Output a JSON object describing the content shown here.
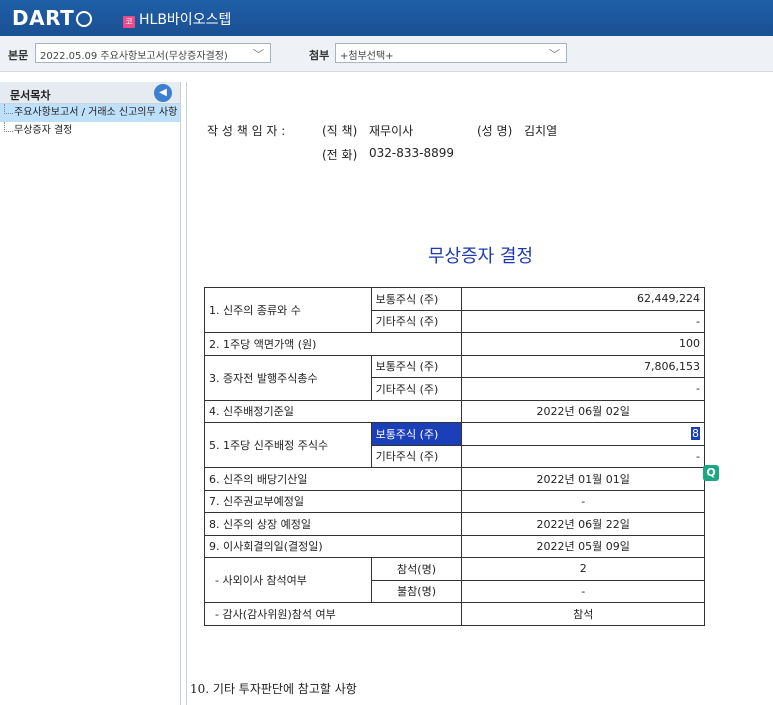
{
  "header": {
    "logo": "DART",
    "corp_badge": "코",
    "corp_name": "HLB바이오스텝"
  },
  "toolbar": {
    "main_label": "본문",
    "main_value": "2022.05.09  주요사항보고서(무상증자결정)",
    "attach_label": "첨부",
    "attach_value": "+첨부선택+"
  },
  "sidebar": {
    "title": "문서목차",
    "items": [
      {
        "label": "주요사항보고서 / 거래소 신고의무 사항"
      },
      {
        "label": "무상증자 결정"
      }
    ]
  },
  "signer": {
    "role_label": "작 성 책 임 자 :",
    "position_label": "(직  책)",
    "position_value": "재무이사",
    "name_label": "(성  명)",
    "name_value": "김치열",
    "phone_label": "(전  화)",
    "phone_value": "032-833-8899"
  },
  "doc_title": "무상증자 결정",
  "table": {
    "r1_label": "1. 신주의 종류와 수",
    "r1a_type": "보통주식 (주)",
    "r1a_value": "62,449,224",
    "r1b_type": "기타주식 (주)",
    "r1b_value": "-",
    "r2_label": "2. 1주당 액면가액 (원)",
    "r2_value": "100",
    "r3_label": "3. 증자전 발행주식총수",
    "r3a_type": "보통주식 (주)",
    "r3a_value": "7,806,153",
    "r3b_type": "기타주식 (주)",
    "r3b_value": "-",
    "r4_label": "4. 신주배정기준일",
    "r4_value": "2022년 06월 02일",
    "r5_label": "5. 1주당 신주배정 주식수",
    "r5a_type": "보통주식 (주)",
    "r5a_value": "8",
    "r5b_type": "기타주식 (주)",
    "r5b_value": "-",
    "r6_label": "6. 신주의 배당기산일",
    "r6_value": "2022년 01월 01일",
    "r7_label": "7. 신주권교부예정일",
    "r7_value": "-",
    "r8_label": "8. 신주의 상장 예정일",
    "r8_value": "2022년 06월 22일",
    "r9_label": "9. 이사회결의일(결정일)",
    "r9_value": "2022년 05월 09일",
    "r10_label": "- 사외이사 참석여부",
    "r10a_type": "참석(명)",
    "r10a_value": "2",
    "r10b_type": "불참(명)",
    "r10b_value": "-",
    "r11_label": "- 감사(감사위원)참석 여부",
    "r11_value": "참석"
  },
  "footer_note": "10. 기타 투자판단에 참고할 사항",
  "float_icon": "Q"
}
